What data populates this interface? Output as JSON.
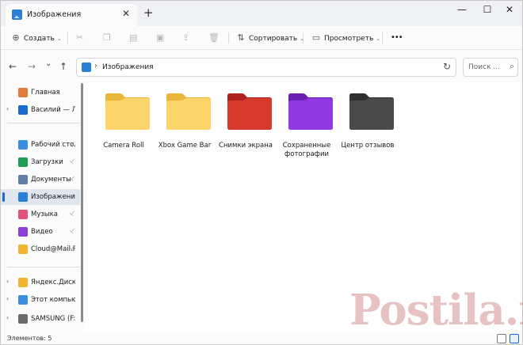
{
  "window": {
    "tab_title": "Изображения",
    "tab_close": "✕",
    "new_tab": "+",
    "minimize": "—",
    "maximize": "☐",
    "close": "✕"
  },
  "toolbar": {
    "create_label": "Создать",
    "sort_label": "Сортировать",
    "view_label": "Просмотреть",
    "more_label": "•••",
    "icons": [
      "add-icon",
      "cut-icon",
      "copy-icon",
      "paste-icon",
      "rename-icon",
      "share-icon",
      "delete-icon",
      "sort-icon",
      "view-icon"
    ]
  },
  "address": {
    "path": "Изображения",
    "search_placeholder": "Поиск ...",
    "back": "←",
    "forward": "→",
    "recent": "⌄",
    "up": "↑",
    "separator": "›",
    "refresh": "↻",
    "search_icon": "⌕"
  },
  "sidebar": {
    "items": [
      {
        "label": "Главная",
        "expander": "",
        "icon_color": "#e07b39",
        "icon": "home-icon",
        "pinned": false,
        "selected": false
      },
      {
        "label": "Василий — Личное",
        "expander": "›",
        "icon_color": "#1b6ad0",
        "icon": "onedrive-cloud-icon",
        "pinned": false,
        "selected": false
      },
      {
        "label": "Рабочий стол",
        "expander": "",
        "icon_color": "#3a8de0",
        "icon": "desktop-icon",
        "pinned": true,
        "selected": false
      },
      {
        "label": "Загрузки",
        "expander": "",
        "icon_color": "#1f9d55",
        "icon": "downloads-icon",
        "pinned": true,
        "selected": false
      },
      {
        "label": "Документы",
        "expander": "",
        "icon_color": "#5f7fa8",
        "icon": "documents-icon",
        "pinned": true,
        "selected": false
      },
      {
        "label": "Изображения",
        "expander": "",
        "icon_color": "#2a7ed6",
        "icon": "pictures-icon",
        "pinned": true,
        "selected": true
      },
      {
        "label": "Музыка",
        "expander": "",
        "icon_color": "#e0527a",
        "icon": "music-icon",
        "pinned": true,
        "selected": false
      },
      {
        "label": "Видео",
        "expander": "",
        "icon_color": "#8b3fd6",
        "icon": "video-icon",
        "pinned": true,
        "selected": false
      },
      {
        "label": "Cloud@Mail.Ru",
        "expander": "",
        "icon_color": "#f2b632",
        "icon": "folder-icon",
        "pinned": true,
        "selected": false
      },
      {
        "label": "Яндекс.Диск",
        "expander": "›",
        "icon_color": "#f2b632",
        "icon": "folder-icon",
        "pinned": false,
        "selected": false
      },
      {
        "label": "Этот компьютер",
        "expander": "›",
        "icon_color": "#3a8de0",
        "icon": "computer-icon",
        "pinned": false,
        "selected": false
      },
      {
        "label": "SAMSUNG (F:)",
        "expander": "›",
        "icon_color": "#6b6b6b",
        "icon": "drive-icon",
        "pinned": false,
        "selected": false
      }
    ],
    "pin_glyph": "📌"
  },
  "folders": [
    {
      "name": "Camera Roll",
      "color_back": "#eab53a",
      "color_front": "#fbd46a"
    },
    {
      "name": "Xbox Game Bar",
      "color_back": "#eab53a",
      "color_front": "#fbd46a"
    },
    {
      "name": "Снимки экрана",
      "color_back": "#b02020",
      "color_front": "#d63a2c"
    },
    {
      "name": "Сохраненные фотографии",
      "color_back": "#6a1fb0",
      "color_front": "#8e3ae0"
    },
    {
      "name": "Центр отзывов",
      "color_back": "#2e2e2e",
      "color_front": "#4a4a4a"
    }
  ],
  "status": {
    "items_count": "Элементов: 5"
  },
  "watermark": {
    "text": "Postila.ru"
  },
  "colors": {
    "accent": "#1b6ad0",
    "selection": "#dfe6f0"
  }
}
